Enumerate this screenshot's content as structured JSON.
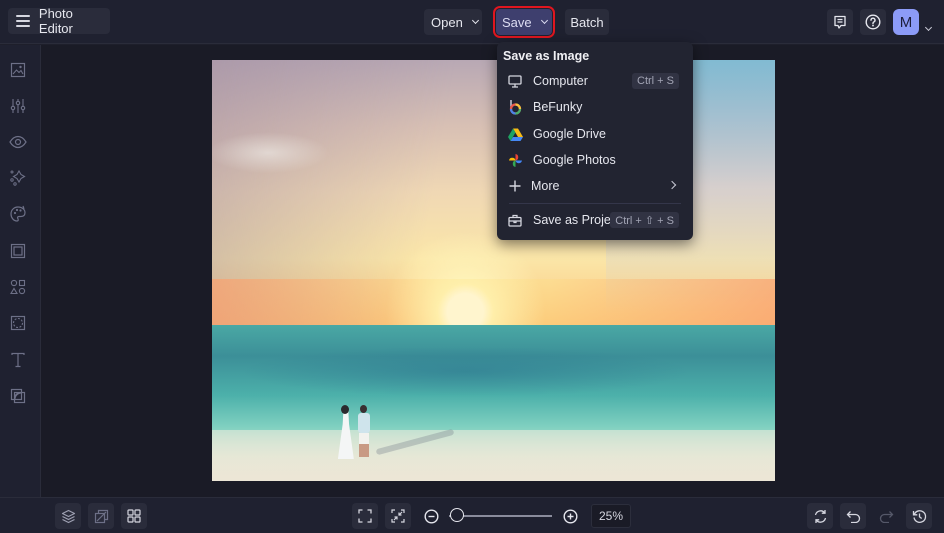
{
  "header": {
    "app_title": "Photo Editor",
    "menu_icon": "hamburger-menu-icon",
    "buttons": {
      "open": "Open",
      "save": "Save",
      "batch": "Batch"
    },
    "right_icons": [
      "comment-icon",
      "help-icon"
    ],
    "avatar_initial": "M"
  },
  "save_menu": {
    "heading": "Save as Image",
    "items": [
      {
        "label": "Computer",
        "icon": "monitor-icon",
        "shortcut": "Ctrl + S"
      },
      {
        "label": "BeFunky",
        "icon": "befunky-logo-icon",
        "shortcut": ""
      },
      {
        "label": "Google Drive",
        "icon": "google-drive-icon",
        "shortcut": ""
      },
      {
        "label": "Google Photos",
        "icon": "google-photos-icon",
        "shortcut": ""
      },
      {
        "label": "More",
        "icon": "plus-icon",
        "shortcut": "",
        "submenu": true
      },
      {
        "label": "Save as Project",
        "icon": "briefcase-icon",
        "shortcut": "Ctrl + ⇧ + S"
      }
    ]
  },
  "sidebar": {
    "items": [
      {
        "name": "image-manager",
        "icon": "image-icon"
      },
      {
        "name": "edit",
        "icon": "sliders-icon"
      },
      {
        "name": "touch-up",
        "icon": "eye-icon"
      },
      {
        "name": "effects",
        "icon": "sparkle-icon"
      },
      {
        "name": "artsy",
        "icon": "palette-icon"
      },
      {
        "name": "frames",
        "icon": "frame-icon"
      },
      {
        "name": "graphics",
        "icon": "shapes-icon"
      },
      {
        "name": "overlays",
        "icon": "overlay-icon"
      },
      {
        "name": "text",
        "icon": "text-icon"
      },
      {
        "name": "textures",
        "icon": "texture-icon"
      }
    ]
  },
  "bottom": {
    "left_icons": [
      "layers-icon",
      "compare-icon",
      "grid-icon"
    ],
    "fit_icon": "fit-screen-icon",
    "actual_size_icon": "shrink-icon",
    "zoom_out_icon": "zoom-out-icon",
    "zoom_in_icon": "zoom-in-icon",
    "zoom_level": "25%",
    "zoom_slider_fraction": 0.08,
    "right_icons": [
      "reset-icon",
      "undo-icon",
      "redo-icon",
      "history-icon"
    ]
  },
  "colors": {
    "accent": "#3e3f6e",
    "highlight_outline": "#e0161f",
    "avatar": "#8c9bf7"
  }
}
